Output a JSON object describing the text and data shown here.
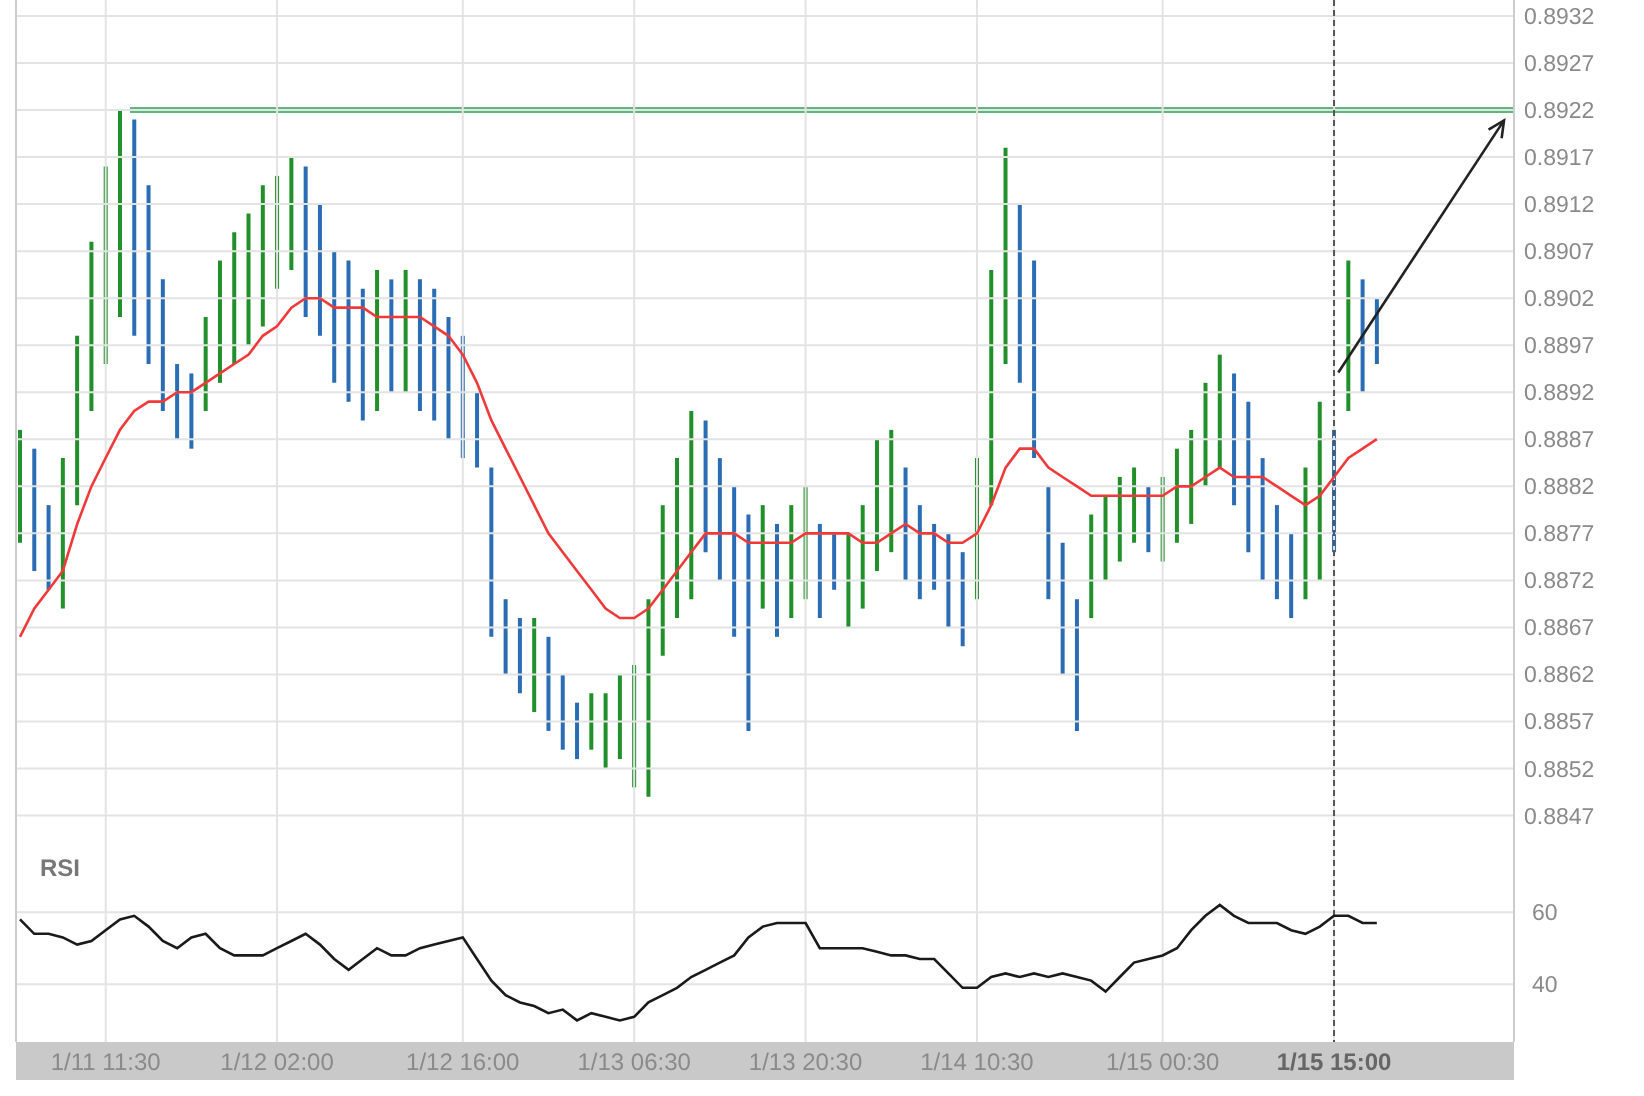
{
  "price_chart": {
    "chart_data": {
      "type": "line",
      "series": [
        {
          "color": "#f03a3a",
          "values": [
            0.8866,
            0.8869,
            0.8871,
            0.8873,
            0.8878,
            0.8882,
            0.8885,
            0.8888,
            0.889,
            0.8891,
            0.8891,
            0.8892,
            0.8892,
            0.8893,
            0.8894,
            0.8895,
            0.8896,
            0.8898,
            0.8899,
            0.8901,
            0.8902,
            0.8902,
            0.8901,
            0.8901,
            0.8901,
            0.89,
            0.89,
            0.89,
            0.89,
            0.8899,
            0.8898,
            0.8896,
            0.8893,
            0.8889,
            0.8886,
            0.8883,
            0.888,
            0.8877,
            0.8875,
            0.8873,
            0.8871,
            0.8869,
            0.8868,
            0.8868,
            0.8869,
            0.8871,
            0.8873,
            0.8875,
            0.8877,
            0.8877,
            0.8877,
            0.8876,
            0.8876,
            0.8876,
            0.8876,
            0.8877,
            0.8877,
            0.8877,
            0.8877,
            0.8876,
            0.8876,
            0.8877,
            0.8878,
            0.8877,
            0.8877,
            0.8876,
            0.8876,
            0.8877,
            0.888,
            0.8884,
            0.8886,
            0.8886,
            0.8884,
            0.8883,
            0.8882,
            0.8881,
            0.8881,
            0.8881,
            0.8881,
            0.8881,
            0.8881,
            0.8882,
            0.8882,
            0.8883,
            0.8884,
            0.8883,
            0.8883,
            0.8883,
            0.8882,
            0.8881,
            0.888,
            0.8881,
            0.8883,
            0.8885,
            0.8886,
            0.8887
          ]
        }
      ],
      "ylim": [
        0.88444,
        0.89337
      ],
      "grid": true,
      "yticks": [
        0.8932,
        0.8927,
        0.8922,
        0.8917,
        0.8912,
        0.8907,
        0.8902,
        0.8897,
        0.8892,
        0.8887,
        0.8882,
        0.8877,
        0.8872,
        0.8867,
        0.8862,
        0.8857,
        0.8852,
        0.8847
      ]
    }
  },
  "rsi_chart": {
    "chart_data": {
      "type": "line",
      "title": "RSI",
      "categories": [
        null,
        null,
        null,
        null,
        null,
        null,
        "1/11 11:30",
        null,
        null,
        null,
        null,
        null,
        null,
        null,
        null,
        null,
        null,
        null,
        "1/12 02:00",
        null,
        null,
        null,
        null,
        null,
        null,
        null,
        null,
        null,
        null,
        null,
        null,
        "1/12 16:00",
        null,
        null,
        null,
        null,
        null,
        null,
        null,
        null,
        null,
        null,
        null,
        "1/13 06:30",
        null,
        null,
        null,
        null,
        null,
        null,
        null,
        null,
        null,
        null,
        null,
        "1/13 20:30",
        null,
        null,
        null,
        null,
        null,
        null,
        null,
        null,
        null,
        null,
        null,
        "1/14 10:30",
        null,
        null,
        null,
        null,
        null,
        null,
        null,
        null,
        null,
        null,
        null,
        null,
        "1/15 00:30",
        null,
        null,
        null,
        null,
        null,
        null,
        null,
        null,
        null,
        null,
        null,
        "1/15 15:00",
        null,
        null,
        null
      ],
      "series": [
        {
          "color": "#1a1a1a",
          "values": [
            58,
            54,
            54,
            53,
            51,
            52,
            55,
            58,
            59,
            56,
            52,
            50,
            53,
            54,
            50,
            48,
            48,
            48,
            50,
            52,
            54,
            51,
            47,
            44,
            47,
            50,
            48,
            48,
            50,
            51,
            52,
            53,
            47,
            41,
            37,
            35,
            34,
            32,
            33,
            30,
            32,
            31,
            30,
            31,
            35,
            37,
            39,
            42,
            44,
            46,
            48,
            53,
            56,
            57,
            57,
            57,
            50,
            50,
            50,
            50,
            49,
            48,
            48,
            47,
            47,
            43,
            39,
            39,
            42,
            43,
            42,
            43,
            42,
            43,
            42,
            41,
            38,
            42,
            46,
            47,
            48,
            50,
            55,
            59,
            62,
            59,
            57,
            57,
            57,
            55,
            54,
            56,
            59,
            59,
            57,
            57
          ]
        }
      ],
      "ylim": [
        24,
        80
      ],
      "yticks": [
        60,
        40
      ],
      "grid": true
    }
  }
}
